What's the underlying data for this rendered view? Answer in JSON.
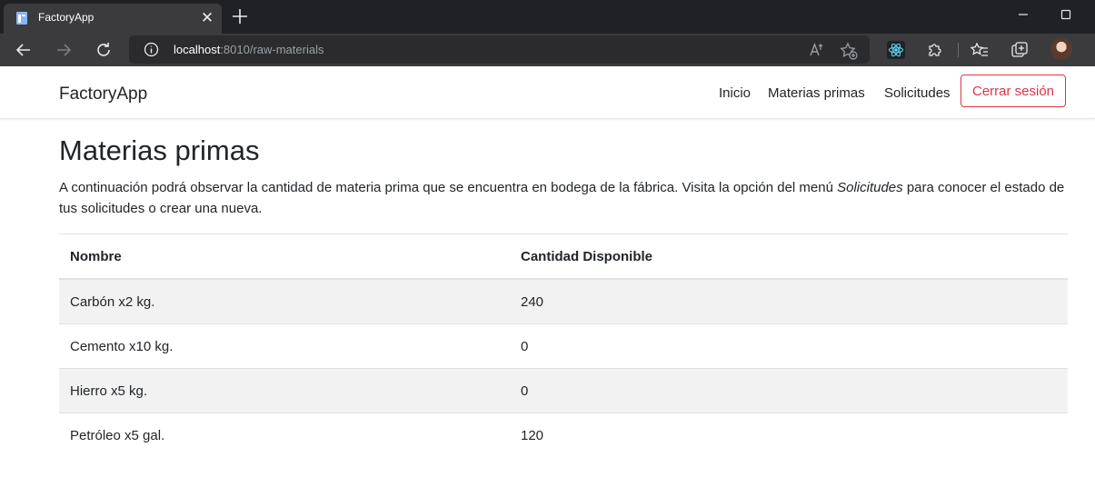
{
  "browser": {
    "tab_title": "FactoryApp",
    "url_host": "localhost",
    "url_rest": ":8010/raw-materials"
  },
  "navbar": {
    "brand": "FactoryApp",
    "links": [
      "Inicio",
      "Materias primas",
      "Solicitudes"
    ],
    "logout_label": "Cerrar sesión",
    "logout_color": "#dc3545"
  },
  "page": {
    "title": "Materias primas",
    "intro_before": "A continuación podrá observar la cantidad de materia prima que se encuentra en bodega de la fábrica. Visita la opción del menú ",
    "intro_em": "Solicitudes",
    "intro_after": " para conocer el estado de tus solicitudes o crear una nueva."
  },
  "table": {
    "headers": [
      "Nombre",
      "Cantidad Disponible"
    ],
    "rows": [
      [
        "Carbón x2 kg.",
        "240"
      ],
      [
        "Cemento x10 kg.",
        "0"
      ],
      [
        "Hierro x5 kg.",
        "0"
      ],
      [
        "Petróleo x5 gal.",
        "120"
      ]
    ]
  }
}
